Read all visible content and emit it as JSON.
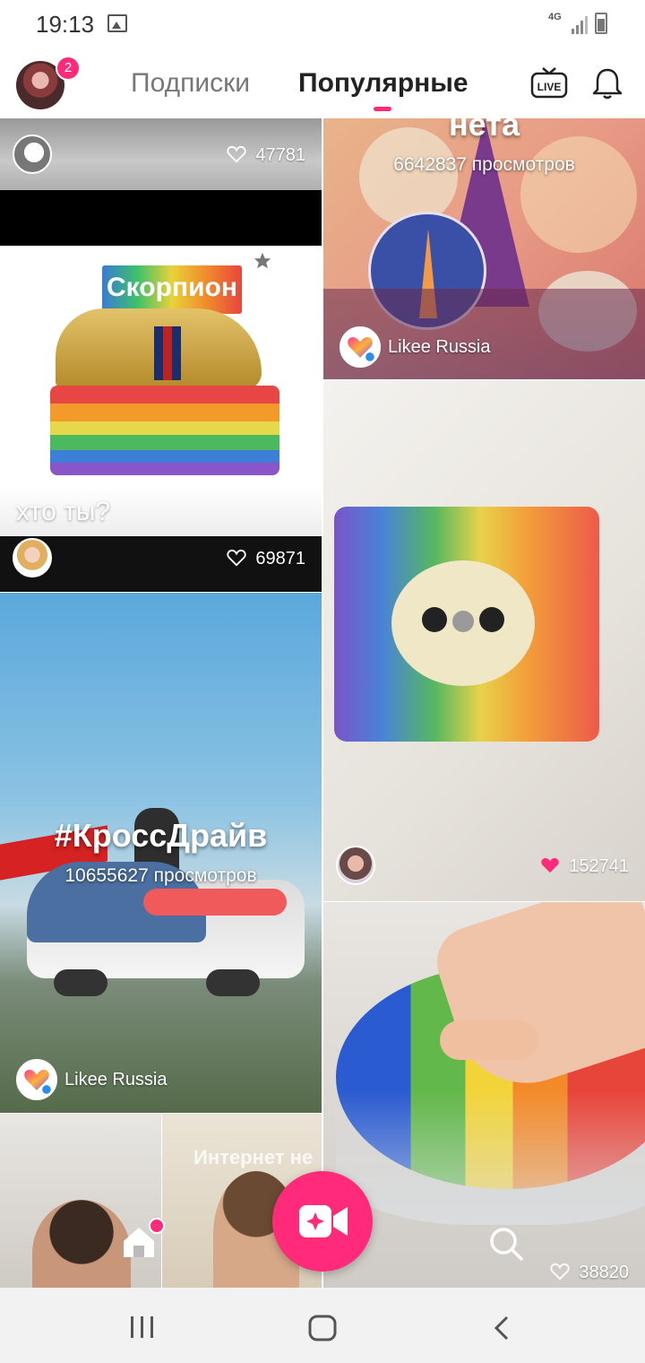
{
  "status": {
    "time": "19:13",
    "network": "4G"
  },
  "header": {
    "notification_count": "2",
    "tabs": [
      {
        "label": "Подписки"
      },
      {
        "label": "Популярные"
      }
    ],
    "live_label": "LIVE"
  },
  "feed": {
    "card1": {
      "likes": "47781"
    },
    "card2": {
      "sticker": "Скорпион",
      "caption": "хто ты?",
      "likes": "69871"
    },
    "card3": {
      "title_partial": "нета",
      "views": "6642837 просмотров",
      "author": "Likee Russia"
    },
    "card4": {
      "likes": "152741"
    },
    "card5": {
      "title": "#КроссДрайв",
      "views": "10655627 просмотров",
      "author": "Likee Russia"
    },
    "card6": {
      "overlay_text": "Интернет не"
    },
    "card7": {
      "likes": "38820"
    }
  },
  "colors": {
    "accent": "#ff2b7a"
  }
}
